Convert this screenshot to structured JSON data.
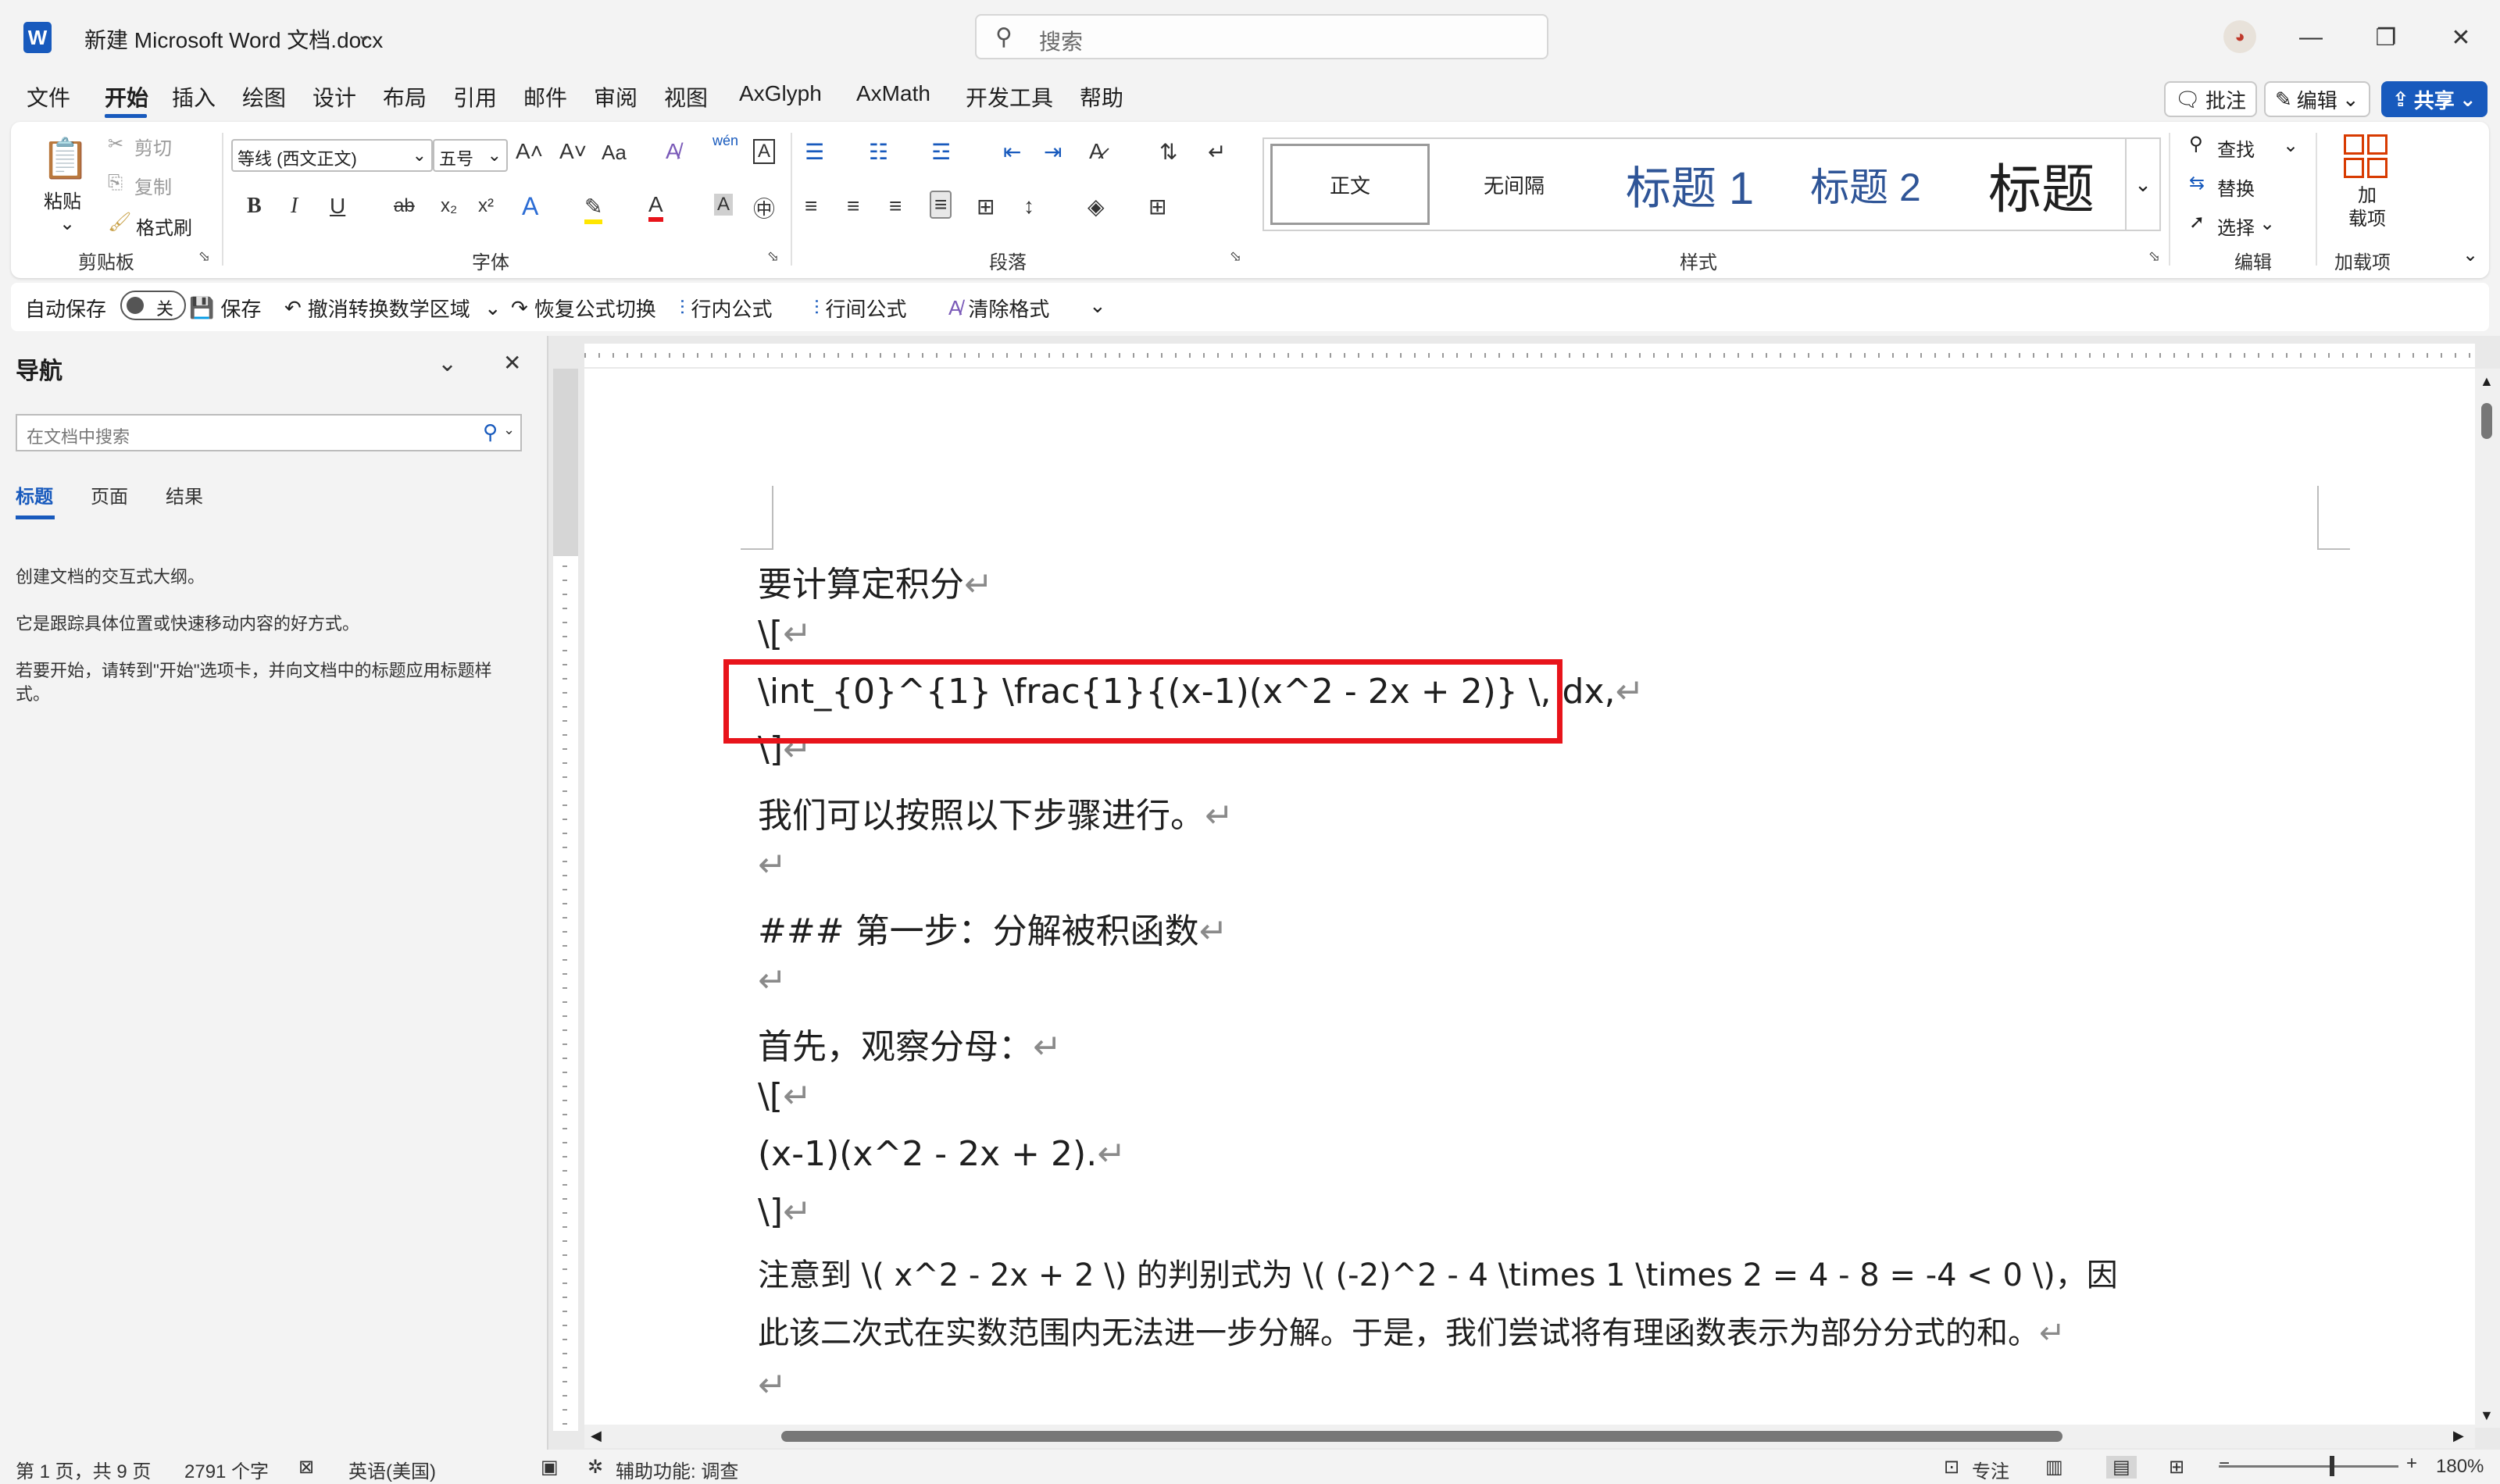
{
  "titlebar": {
    "doc_title": "新建 Microsoft Word 文档.docx",
    "search_placeholder": "搜索",
    "app_icon_letter": "W"
  },
  "menu": {
    "tabs": [
      "文件",
      "开始",
      "插入",
      "绘图",
      "设计",
      "布局",
      "引用",
      "邮件",
      "审阅",
      "视图",
      "AxGlyph",
      "AxMath",
      "开发工具",
      "帮助"
    ],
    "active_tab": "开始",
    "comment_btn": "批注",
    "edit_btn": "编辑",
    "share_btn": "共享"
  },
  "ribbon": {
    "clipboard": {
      "paste": "粘贴",
      "cut": "剪切",
      "copy": "复制",
      "format_painter": "格式刷",
      "label": "剪贴板"
    },
    "font": {
      "font_name": "等线 (西文正文)",
      "font_size": "五号",
      "label": "字体",
      "change_case": "Aa",
      "bold": "B",
      "italic": "I",
      "underline": "U",
      "strike": "ab",
      "subscript": "x₂",
      "superscript": "x²",
      "wen": "wén"
    },
    "paragraph": {
      "label": "段落"
    },
    "styles": {
      "normal": "正文",
      "no_spacing": "无间隔",
      "heading1": "标题 1",
      "heading2": "标题 2",
      "title": "标题",
      "label": "样式"
    },
    "editing": {
      "find": "查找",
      "replace": "替换",
      "select": "选择",
      "label": "编辑"
    },
    "addins": {
      "addin": "加\n载项",
      "label": "加载项"
    }
  },
  "qat": {
    "autosave": "自动保存",
    "toggle_state": "关",
    "save": "保存",
    "undo_convert": "撤消转换数学区域",
    "restore_formula": "恢复公式切换",
    "inline_formula": "行内公式",
    "display_formula": "行间公式",
    "clear_format": "清除格式"
  },
  "nav": {
    "title": "导航",
    "search_placeholder": "在文档中搜索",
    "tabs": [
      "标题",
      "页面",
      "结果"
    ],
    "p1": "创建文档的交互式大纲。",
    "p2": "它是跟踪具体位置或快速移动内容的好方式。",
    "p3": "若要开始，请转到\"开始\"选项卡，并向文档中的标题应用标题样式。"
  },
  "document": {
    "lines": [
      "要计算定积分",
      "\\[",
      "\\int_{0}^{1} \\frac{1}{(x-1)(x^2 - 2x + 2)} \\, dx,",
      "\\]",
      "我们可以按照以下步骤进行。",
      "",
      "### 第一步：分解被积函数",
      "",
      "首先，观察分母：",
      "\\[",
      "(x-1)(x^2 - 2x + 2).",
      "\\]",
      "注意到 \\( x^2 - 2x + 2 \\) 的判别式为 \\( (-2)^2 - 4 \\times 1 \\times 2 = 4 - 8 = -4 < 0 \\)，因",
      "此该二次式在实数范围内无法进一步分解。于是，我们尝试将有理函数表示为部分分式的和。",
      ""
    ],
    "pilcrow": "↵"
  },
  "status": {
    "page": "第 1 页，共 9 页",
    "words": "2791 个字",
    "language": "英语(美国)",
    "accessibility": "辅助功能: 调查",
    "focus": "专注",
    "zoom": "180%"
  },
  "colors": {
    "accent": "#185abd",
    "highlight_box": "#e8141b"
  }
}
